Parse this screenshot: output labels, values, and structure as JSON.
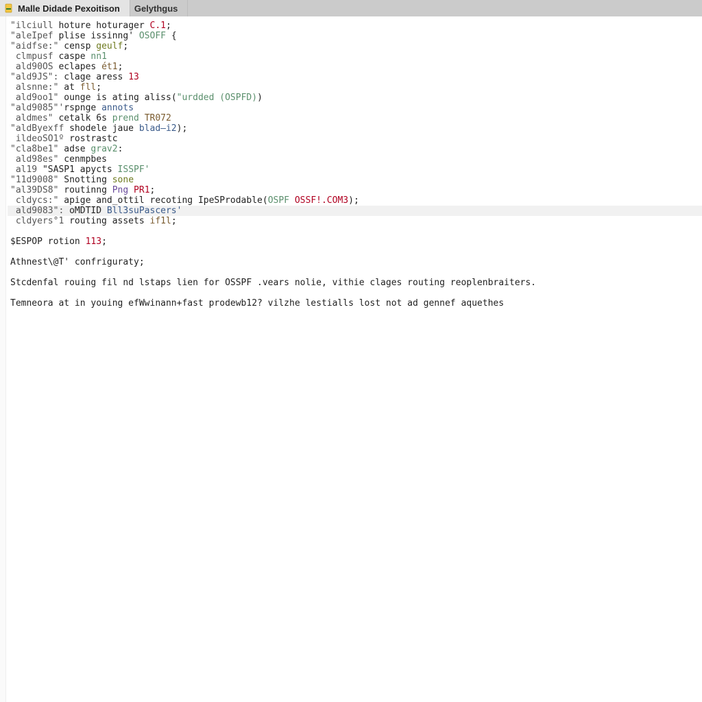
{
  "tabs": {
    "active": {
      "label": "Malle Didade Pexoitison"
    },
    "inactive": {
      "label": "Gelythgus"
    }
  },
  "icons": {
    "file_icon_fill": "#f5c542",
    "file_icon_accent": "#2e7d32"
  },
  "highlight_index": 18,
  "code_lines": [
    {
      "tokens": [
        {
          "t": "\"ilciull ",
          "c": "t-dim"
        },
        {
          "t": "hoture hoturager ",
          "c": "t-id"
        },
        {
          "t": "C.1",
          "c": "t-red"
        },
        {
          "t": ";",
          "c": "t-id"
        }
      ]
    },
    {
      "tokens": [
        {
          "t": "\"aleIpef ",
          "c": "t-dim"
        },
        {
          "t": "plise issinng' ",
          "c": "t-id"
        },
        {
          "t": "OSOFF",
          "c": "t-teal"
        },
        {
          "t": " {",
          "c": "t-id"
        }
      ]
    },
    {
      "tokens": [
        {
          "t": "\"aidfse:\" ",
          "c": "t-dim"
        },
        {
          "t": "censp ",
          "c": "t-id"
        },
        {
          "t": "geulf",
          "c": "t-olive"
        },
        {
          "t": ";",
          "c": "t-id"
        }
      ]
    },
    {
      "tokens": [
        {
          "t": " clmpusf ",
          "c": "t-dim"
        },
        {
          "t": "caspe ",
          "c": "t-id"
        },
        {
          "t": "nn1",
          "c": "t-teal"
        }
      ]
    },
    {
      "tokens": [
        {
          "t": " ald90OS ",
          "c": "t-dim"
        },
        {
          "t": "eclapes ",
          "c": "t-id"
        },
        {
          "t": "ét1",
          "c": "t-brown"
        },
        {
          "t": ";",
          "c": "t-id"
        }
      ]
    },
    {
      "tokens": [
        {
          "t": "\"ald9JS\": ",
          "c": "t-dim"
        },
        {
          "t": "clage aress ",
          "c": "t-id"
        },
        {
          "t": "13",
          "c": "t-red"
        }
      ]
    },
    {
      "tokens": [
        {
          "t": " alsnne:\" ",
          "c": "t-dim"
        },
        {
          "t": "at ",
          "c": "t-id"
        },
        {
          "t": "fll",
          "c": "t-brown"
        },
        {
          "t": ";",
          "c": "t-id"
        }
      ]
    },
    {
      "tokens": [
        {
          "t": " ald9oo1\" ",
          "c": "t-dim"
        },
        {
          "t": "ounge is ating aliss(",
          "c": "t-id"
        },
        {
          "t": "\"urdded (OSPFD)",
          "c": "t-teal"
        },
        {
          "t": ")",
          "c": "t-id"
        }
      ]
    },
    {
      "tokens": [
        {
          "t": "\"ald9085\"'",
          "c": "t-dim"
        },
        {
          "t": "rspnge ",
          "c": "t-id"
        },
        {
          "t": "annots",
          "c": "t-blue"
        }
      ]
    },
    {
      "tokens": [
        {
          "t": " aldmes\" ",
          "c": "t-dim"
        },
        {
          "t": "cetalk 6s ",
          "c": "t-id"
        },
        {
          "t": "prend ",
          "c": "t-teal"
        },
        {
          "t": "TR072",
          "c": "t-brown"
        }
      ]
    },
    {
      "tokens": [
        {
          "t": "\"aldByexff ",
          "c": "t-dim"
        },
        {
          "t": "shodele jaue ",
          "c": "t-id"
        },
        {
          "t": "blad—i2",
          "c": "t-blue"
        },
        {
          "t": ");",
          "c": "t-id"
        }
      ]
    },
    {
      "tokens": [
        {
          "t": " ildeoSO1º ",
          "c": "t-dim"
        },
        {
          "t": "rostrastc",
          "c": "t-id"
        }
      ]
    },
    {
      "tokens": [
        {
          "t": "\"cla8be1\" ",
          "c": "t-dim"
        },
        {
          "t": "adse ",
          "c": "t-id"
        },
        {
          "t": "grav2",
          "c": "t-teal"
        },
        {
          "t": ":",
          "c": "t-id"
        }
      ]
    },
    {
      "tokens": [
        {
          "t": " ald98es\" ",
          "c": "t-dim"
        },
        {
          "t": "cenmpbes",
          "c": "t-id"
        }
      ]
    },
    {
      "tokens": [
        {
          "t": " al19 ",
          "c": "t-dim"
        },
        {
          "t": "\"SASP1 apycts ",
          "c": "t-id"
        },
        {
          "t": "ISSPF'",
          "c": "t-teal"
        }
      ]
    },
    {
      "tokens": [
        {
          "t": "\"11d9008\" ",
          "c": "t-dim"
        },
        {
          "t": "Snotting ",
          "c": "t-id"
        },
        {
          "t": "sone",
          "c": "t-olive"
        }
      ]
    },
    {
      "tokens": [
        {
          "t": "\"al39DS8\" ",
          "c": "t-dim"
        },
        {
          "t": "routinng ",
          "c": "t-id"
        },
        {
          "t": "Png ",
          "c": "t-purple"
        },
        {
          "t": "PR1",
          "c": "t-red"
        },
        {
          "t": ";",
          "c": "t-id"
        }
      ]
    },
    {
      "tokens": [
        {
          "t": " cldycs:\" ",
          "c": "t-dim"
        },
        {
          "t": "apige and_ottil recoting IpeSProdable(",
          "c": "t-id"
        },
        {
          "t": "OSPF ",
          "c": "t-teal"
        },
        {
          "t": "OSSF!.COM3",
          "c": "t-red"
        },
        {
          "t": ");",
          "c": "t-id"
        }
      ]
    },
    {
      "tokens": [
        {
          "t": " ald9083\": ",
          "c": "t-dim"
        },
        {
          "t": "oMDTID ",
          "c": "t-id"
        },
        {
          "t": "Bll3suPascers'",
          "c": "t-blue"
        }
      ]
    },
    {
      "tokens": [
        {
          "t": " cldyers°1 ",
          "c": "t-dim"
        },
        {
          "t": "routing assets ",
          "c": "t-id"
        },
        {
          "t": "if1l",
          "c": "t-brown"
        },
        {
          "t": ";",
          "c": "t-id"
        }
      ]
    }
  ],
  "after_block": {
    "line1": {
      "a": "$ESPOP rotion ",
      "b": "113",
      "c": ";"
    },
    "line2": "Athnest\\@T' confriguraty;",
    "para1": "Stcdenfal rouing fil nd lstaps lien for OSSPF .vears nolie, vithie clages routing reoplenbraiters.",
    "para2": "Temneora at in youing efWwinann+fast prodewb12? vilzhe lestialls lost not ad gennef aquethes"
  }
}
